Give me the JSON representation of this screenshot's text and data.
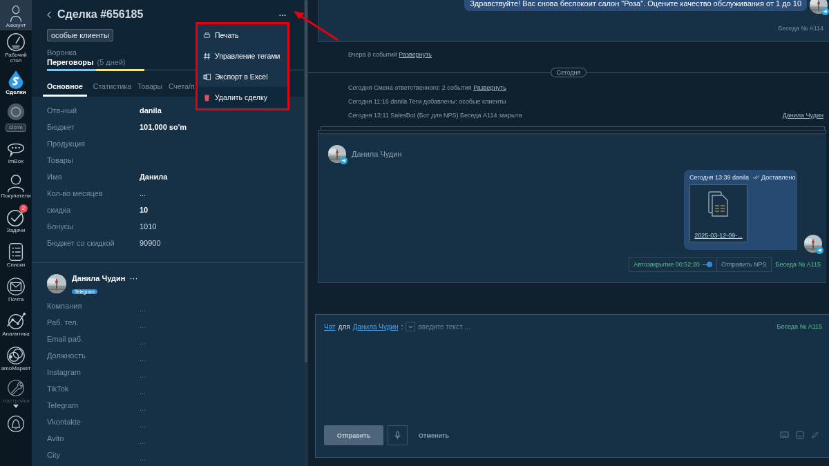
{
  "sidebar": {
    "items": [
      {
        "label": "Аккаунт",
        "selected": false,
        "disabled": false,
        "kind": "plain"
      },
      {
        "label": "Рабочий стол",
        "selected": false,
        "disabled": false,
        "kind": "plain"
      },
      {
        "label": "Сделки",
        "selected": true,
        "disabled": false,
        "kind": "plain"
      },
      {
        "label": "i2crm",
        "selected": false,
        "disabled": false,
        "kind": "pill"
      },
      {
        "label": "imBox",
        "selected": false,
        "disabled": false,
        "kind": "plain"
      },
      {
        "label": "Покупатели",
        "selected": false,
        "disabled": false,
        "kind": "plain"
      },
      {
        "label": "Задачи",
        "selected": false,
        "disabled": false,
        "kind": "plain",
        "badge": "2"
      },
      {
        "label": "Списки",
        "selected": false,
        "disabled": false,
        "kind": "plain"
      },
      {
        "label": "Почта",
        "selected": false,
        "disabled": false,
        "kind": "plain"
      },
      {
        "label": "Аналитика",
        "selected": false,
        "disabled": false,
        "kind": "plain"
      },
      {
        "label": "amoМаркет",
        "selected": false,
        "disabled": false,
        "kind": "plain"
      },
      {
        "label": "Настройки",
        "selected": false,
        "disabled": true,
        "kind": "plain"
      }
    ]
  },
  "deal": {
    "title": "Сделка #656185",
    "more": "···",
    "tag": "особые клиенты",
    "pipeline_label": "Воронка",
    "stage": "Переговоры",
    "stage_duration": "(5 дней)",
    "progress": {
      "level": 0.38
    },
    "tabs": [
      {
        "label": "Основное",
        "selected": true
      },
      {
        "label": "Статистика",
        "selected": false
      },
      {
        "label": "Товары",
        "selected": false
      },
      {
        "label": "Счета/п",
        "selected": false
      }
    ],
    "fields": [
      {
        "label": "Отв-ный",
        "value": "danila",
        "bold": true
      },
      {
        "label": "Бюджет",
        "value": "101,000 so'm",
        "bold": true
      },
      {
        "label": "Продукция"
      },
      {
        "label": "Товары"
      },
      {
        "label": "Имя",
        "value": "Данила",
        "bold": true
      },
      {
        "label": "Кол-во месяцев",
        "value": "...",
        "bold": false
      },
      {
        "label": "скидка",
        "value": "10",
        "bold": true
      },
      {
        "label": "Бонусы",
        "value": "1010",
        "bold": false
      },
      {
        "label": "Бюджет со скидкой",
        "value": "90900",
        "bold": false
      }
    ]
  },
  "menu": {
    "items": [
      {
        "label": "Печать",
        "selected": false
      },
      {
        "label": "Управление тегами",
        "selected": false
      },
      {
        "label": "Экспорт в Excel",
        "selected": false
      },
      {
        "label": "Удалить сделку",
        "selected": true
      }
    ]
  },
  "contact": {
    "name": "Данила Чудин",
    "more": "···",
    "channel": "Telegram",
    "fields": [
      {
        "label": "Компания",
        "value": "..."
      },
      {
        "label": "Раб. тел.",
        "value": "..."
      },
      {
        "label": "Email раб.",
        "value": "..."
      },
      {
        "label": "Должность",
        "value": "..."
      },
      {
        "label": "Instagram",
        "value": "..."
      },
      {
        "label": "TikTok",
        "value": "..."
      },
      {
        "label": "Telegram",
        "value": "..."
      },
      {
        "label": "Vkontakte",
        "value": "..."
      },
      {
        "label": "Avito",
        "value": "..."
      },
      {
        "label": "City",
        "value": "..."
      }
    ]
  },
  "feed": {
    "top_message": "Здравствуйте! Вас снова беспокоит салон \"Роза\". Оцените качество обслуживания от 1 до 10",
    "top_conversation": "Беседа № A114",
    "yesterday": {
      "text": "Вчера 8 событий",
      "link": "Развернуть"
    },
    "divider": "Сегодня",
    "events": [
      {
        "text": "Сегодня Смена ответственного: 2 события",
        "link": "Развернуть"
      },
      {
        "text": "Сегодня 11:16 danila Теги добавлены: особые клиенты"
      },
      {
        "text": "Сегодня 13:11 SalesBot (Бот для NPS) Беседа A114 закрыта",
        "right_link": "Данила Чудин"
      }
    ],
    "chat": {
      "contact": "Данила Чудин",
      "meta": "Сегодня 13:39 danila",
      "status": "Доставлено",
      "file": "2025-03-12-09-...",
      "autoclose": {
        "label": "Автозакрытие 00:52:20",
        "on": true
      },
      "nps_button": "Отправить NPS",
      "conversation": "Беседа № A115"
    }
  },
  "composer": {
    "chat_link": "Чат",
    "for": "для",
    "contact_link": "Данила Чудин",
    "colon": ":",
    "placeholder": "введите текст ...",
    "conversation": "Беседа № A115",
    "send": "Отправить",
    "send_disabled": true,
    "cancel": "Отменить"
  }
}
